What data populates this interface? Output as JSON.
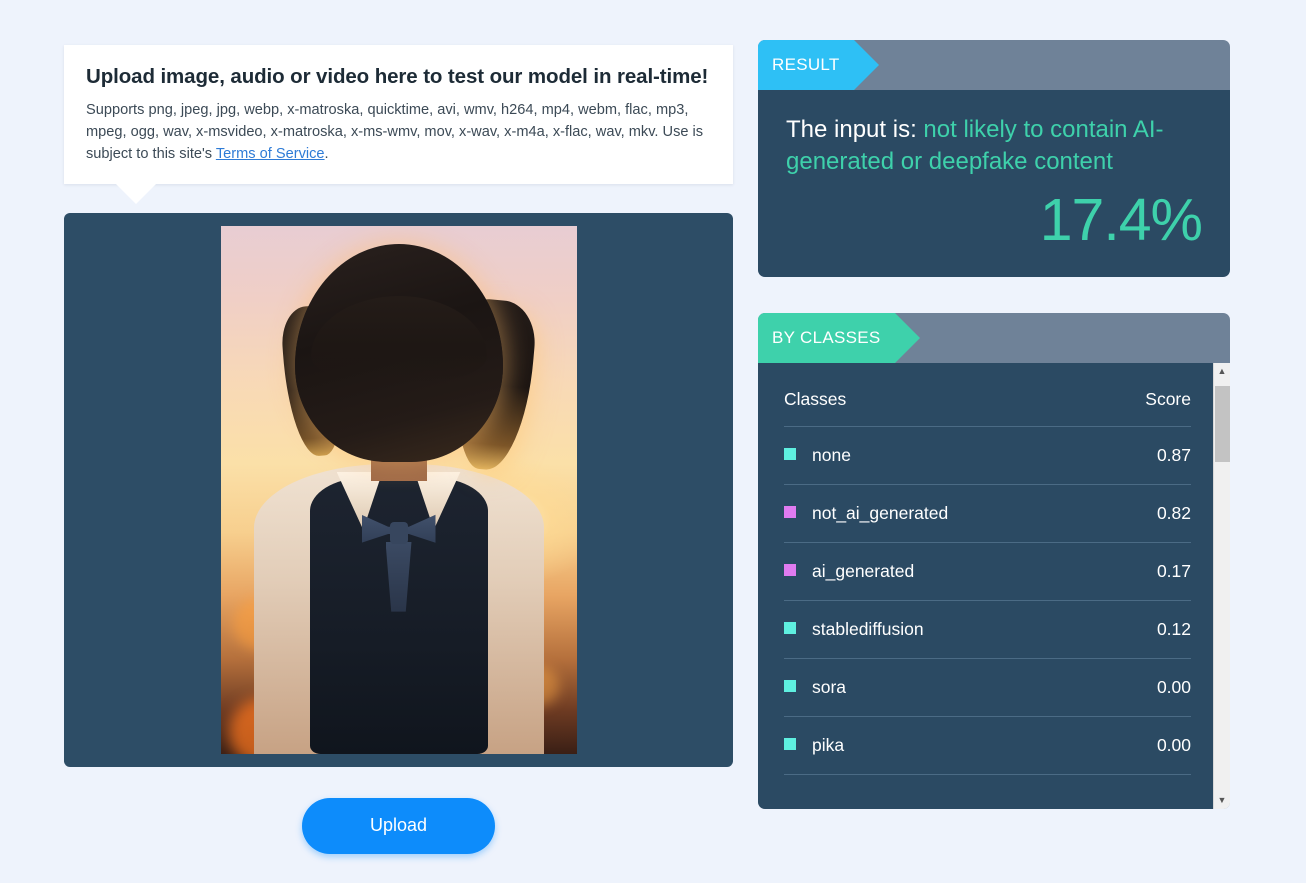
{
  "upload_card": {
    "title": "Upload image, audio or video here to test our model in real-time!",
    "description_prefix": "Supports png, jpeg, jpg, webp, x-matroska, quicktime, avi, wmv, h264, mp4, webm, flac, mp3, mpeg, ogg, wav, x-msvideo, x-matroska, x-ms-wmv, mov, x-wav, x-m4a, x-flac, wav, mkv. Use is subject to this site's ",
    "terms_link": "Terms of Service",
    "description_suffix": "."
  },
  "preview": {
    "alt": "anime style portrait of a girl at sunset",
    "panel_background": "#2d4d66"
  },
  "upload_button": {
    "label": "Upload",
    "color": "#0d8cfb"
  },
  "result_panel": {
    "tag": "RESULT",
    "tag_color": "#2ec0f5",
    "sentence_prefix": "The input is: ",
    "verdict": "not likely to contain AI-generated or deepfake content",
    "verdict_color": "#3ed1ab",
    "percent": "17.4%"
  },
  "classes_panel": {
    "tag": "BY CLASSES",
    "tag_color": "#3ed1ab",
    "columns": {
      "class": "Classes",
      "score": "Score"
    },
    "rows": [
      {
        "label": "none",
        "score": "0.87",
        "color": "#5ff0e0"
      },
      {
        "label": "not_ai_generated",
        "score": "0.82",
        "color": "#e07bf0"
      },
      {
        "label": "ai_generated",
        "score": "0.17",
        "color": "#e07bf0"
      },
      {
        "label": "stablediffusion",
        "score": "0.12",
        "color": "#5ff0e0"
      },
      {
        "label": "sora",
        "score": "0.00",
        "color": "#5ff0e0"
      },
      {
        "label": "pika",
        "score": "0.00",
        "color": "#5ff0e0"
      }
    ],
    "scrollbar": {
      "up_arrow": "▲",
      "down_arrow": "▼"
    }
  },
  "theme": {
    "page_background": "#eef3fc",
    "panel_background": "#2b4a63",
    "panel_header_background": "#6f8298"
  }
}
